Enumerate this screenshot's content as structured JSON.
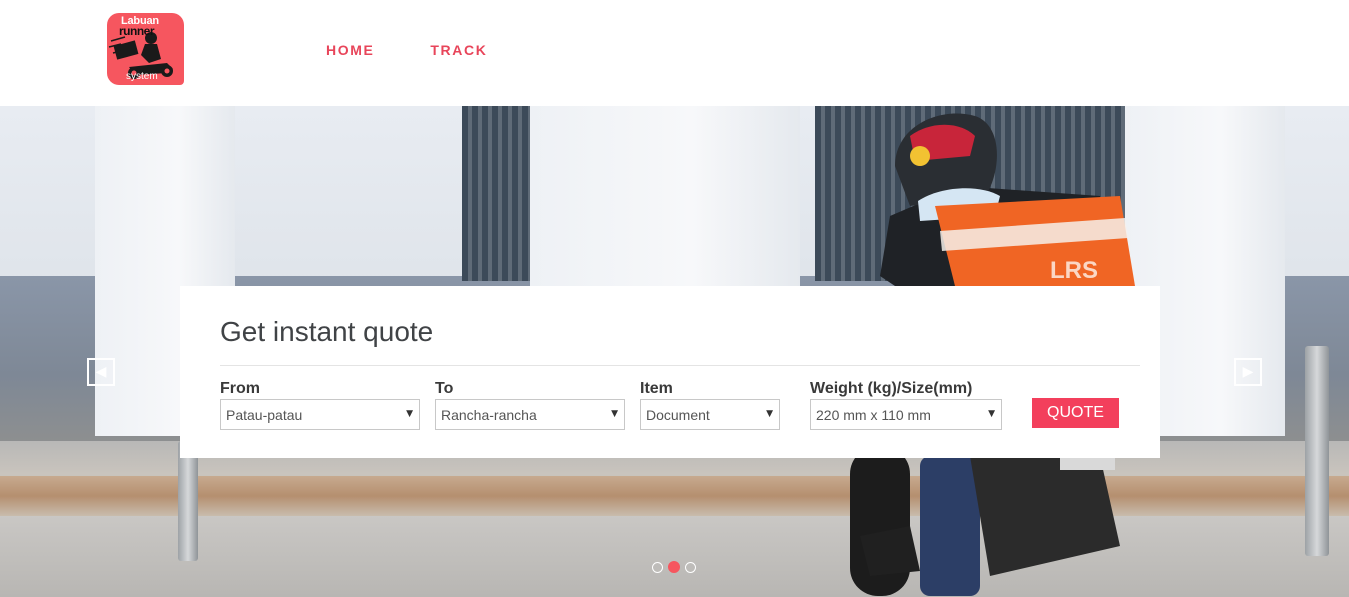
{
  "brand": {
    "logo_top": "Labuan",
    "logo_mid": "runner",
    "logo_bottom": "system",
    "accent": "#f6565f",
    "nav_color": "#e8455a"
  },
  "nav": {
    "items": [
      {
        "label": "HOME"
      },
      {
        "label": "TRACK"
      }
    ]
  },
  "hero": {
    "bag_text": "LRS",
    "prev_icon": "◀",
    "next_icon": "▶",
    "slides": 3,
    "active_slide": 2
  },
  "quote": {
    "title": "Get instant quote",
    "from": {
      "label": "From",
      "value": "Patau-patau"
    },
    "to": {
      "label": "To",
      "value": "Rancha-rancha"
    },
    "item": {
      "label": "Item",
      "value": "Document"
    },
    "weight": {
      "label": "Weight (kg)/Size(mm)",
      "value": "220 mm x 110 mm"
    },
    "caret": "▼",
    "button": "QUOTE",
    "button_color": "#f33f5c"
  }
}
